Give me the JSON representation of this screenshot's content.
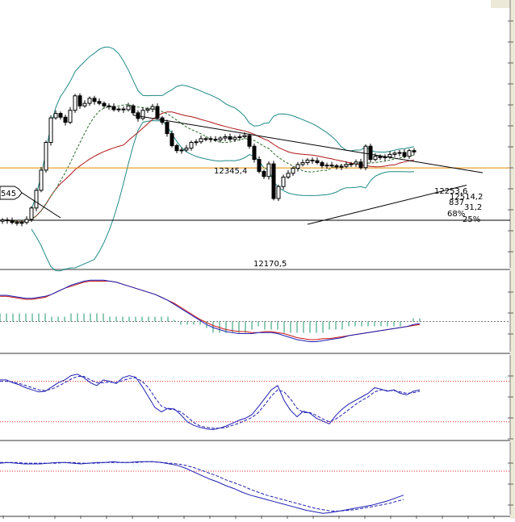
{
  "colors": {
    "background": "#ffffff",
    "scale_strip": "#ece9d8",
    "bollinger": "#1e8a86",
    "ma_long": "#b01818",
    "ma_short": "#2a6a28",
    "candle": "#000000",
    "orange_line": "#e08a00",
    "level_line": "#000000",
    "macd_line": "#1f1fb3",
    "signal_line": "#c81414",
    "histogram": "#1a9a6a",
    "osc_line": "#1f1fb3",
    "osc_dashed": "#1f1fb3",
    "ref_dotted": "#e02020"
  },
  "price_panel": {
    "left_tag": "545",
    "annotations": [
      "12345,4",
      "12253,6",
      "12514,2",
      "837",
      "31,2",
      "68%",
      "25%",
      "12170,5"
    ]
  },
  "chart_data": [
    {
      "type": "candlestick",
      "title": "",
      "ylim": [
        12095,
        12520
      ],
      "x": [
        0,
        1,
        2,
        3,
        4,
        5,
        6,
        7,
        8,
        9,
        10,
        11,
        12,
        13,
        14,
        15,
        16,
        17,
        18,
        19,
        20,
        21,
        22,
        23,
        24,
        25,
        26,
        27,
        28,
        29,
        30,
        31,
        32,
        33,
        34,
        35,
        36,
        37,
        38,
        39,
        40,
        41,
        42,
        43,
        44,
        45,
        46,
        47,
        48,
        49,
        50,
        51,
        52,
        53,
        54,
        55,
        56,
        57,
        58,
        59,
        60,
        61,
        62,
        63,
        64,
        65,
        66,
        67,
        68,
        69,
        70,
        71,
        72,
        73,
        74,
        75,
        76,
        77,
        78,
        79,
        80,
        81,
        82,
        83,
        84,
        85
      ],
      "series": [
        {
          "name": "close",
          "values": [
            12171,
            12170,
            12167,
            12166,
            12167,
            12172,
            12190,
            12218,
            12250,
            12294,
            12333,
            12340,
            12334,
            12326,
            12345,
            12368,
            12352,
            12356,
            12364,
            12359,
            12356,
            12352,
            12351,
            12346,
            12347,
            12346,
            12352,
            12341,
            12332,
            12345,
            12347,
            12351,
            12333,
            12326,
            12308,
            12289,
            12281,
            12282,
            12285,
            12294,
            12295,
            12300,
            12300,
            12299,
            12298,
            12301,
            12303,
            12299,
            12302,
            12303,
            12305,
            12288,
            12267,
            12248,
            12240,
            12260,
            12205,
            12224,
            12239,
            12245,
            12253,
            12259,
            12262,
            12266,
            12265,
            12262,
            12257,
            12258,
            12257,
            12255,
            12256,
            12259,
            12260,
            12263,
            12254,
            12288,
            12267,
            12272,
            12270,
            12271,
            12275,
            12277,
            12278,
            12272,
            12281,
            12279
          ]
        }
      ],
      "level_lines": [
        12253.6,
        12170.5
      ]
    },
    {
      "type": "line",
      "title": "",
      "series": [
        {
          "name": "macd",
          "values": [
            26,
            26,
            25,
            24,
            23,
            23,
            24,
            25,
            27,
            30,
            33,
            36,
            38,
            40,
            41,
            41,
            41,
            40,
            39,
            37,
            35,
            33,
            31,
            29,
            27,
            24,
            21,
            17,
            13,
            9,
            5,
            1,
            -3,
            -6,
            -8,
            -10,
            -11,
            -12,
            -12,
            -12,
            -11,
            -11,
            -11,
            -12,
            -14,
            -16,
            -18,
            -19,
            -20,
            -20,
            -19,
            -18,
            -17,
            -16,
            -14,
            -13,
            -12,
            -11,
            -10,
            -9,
            -8,
            -7,
            -6,
            -5,
            -3,
            -2
          ]
        },
        {
          "name": "signal",
          "values": [
            25,
            25,
            24,
            23,
            22,
            22,
            23,
            24,
            27,
            30,
            33,
            35,
            37,
            39,
            40,
            40,
            40,
            40,
            39,
            37,
            35,
            33,
            31,
            29,
            27,
            24,
            21,
            18,
            14,
            10,
            6,
            2,
            -1,
            -4,
            -6,
            -8,
            -9,
            -10,
            -10,
            -11,
            -11,
            -10,
            -10,
            -11,
            -12,
            -14,
            -16,
            -17,
            -18,
            -18,
            -17,
            -17,
            -16,
            -15,
            -14,
            -13,
            -12,
            -11,
            -10,
            -9,
            -8,
            -7,
            -6,
            -5,
            -4,
            -3
          ]
        }
      ],
      "ylim": [
        -30,
        50
      ]
    },
    {
      "type": "line",
      "title": "",
      "series": [
        {
          "name": "osc",
          "values": [
            74,
            74,
            70,
            67,
            63,
            60,
            57,
            58,
            64,
            70,
            74,
            80,
            82,
            77,
            70,
            66,
            74,
            72,
            69,
            77,
            80,
            78,
            65,
            50,
            35,
            29,
            34,
            33,
            25,
            15,
            10,
            7,
            5,
            4,
            6,
            9,
            13,
            17,
            20,
            25,
            36,
            48,
            60,
            66,
            45,
            31,
            22,
            30,
            27,
            20,
            16,
            12,
            24,
            33,
            40,
            45,
            50,
            55,
            63,
            61,
            58,
            60,
            55,
            53,
            58,
            60
          ]
        },
        {
          "name": "osc_signal",
          "values": [
            72,
            72,
            71,
            69,
            66,
            63,
            60,
            59,
            61,
            65,
            70,
            75,
            79,
            79,
            74,
            70,
            70,
            71,
            70,
            73,
            76,
            77,
            72,
            63,
            49,
            37,
            33,
            32,
            29,
            22,
            14,
            9,
            7,
            6,
            6,
            7,
            10,
            13,
            17,
            21,
            28,
            39,
            51,
            60,
            57,
            47,
            34,
            28,
            28,
            24,
            19,
            15,
            19,
            25,
            32,
            39,
            45,
            50,
            57,
            60,
            59,
            59,
            57,
            55,
            56,
            58
          ]
        }
      ],
      "ylim": [
        0,
        100
      ],
      "reference_lines": [
        72,
        15
      ]
    },
    {
      "type": "line",
      "title": "",
      "series": [
        {
          "name": "line_a",
          "values": [
            71,
            72,
            71,
            70,
            70,
            70,
            71,
            72,
            72,
            71,
            70,
            71,
            72,
            72,
            73,
            72,
            72,
            73,
            73,
            73,
            72,
            70,
            68,
            64,
            59,
            54,
            49,
            45,
            40,
            36,
            31,
            27,
            24,
            21,
            18,
            15,
            12,
            9,
            6,
            4,
            2,
            3,
            5,
            7,
            9,
            11,
            13,
            16,
            19,
            23,
            27
          ]
        },
        {
          "name": "line_b",
          "values": [
            72,
            72,
            72,
            71,
            71,
            71,
            71,
            71,
            72,
            72,
            71,
            71,
            71,
            72,
            72,
            72,
            72,
            72,
            73,
            73,
            72,
            71,
            70,
            68,
            65,
            61,
            57,
            53,
            48,
            44,
            40,
            35,
            31,
            27,
            24,
            21,
            18,
            15,
            12,
            9,
            7,
            5,
            5,
            6,
            7,
            9,
            11,
            13,
            15,
            18,
            21
          ]
        }
      ],
      "ylim": [
        0,
        100
      ],
      "reference_lines": [
        60
      ]
    }
  ]
}
